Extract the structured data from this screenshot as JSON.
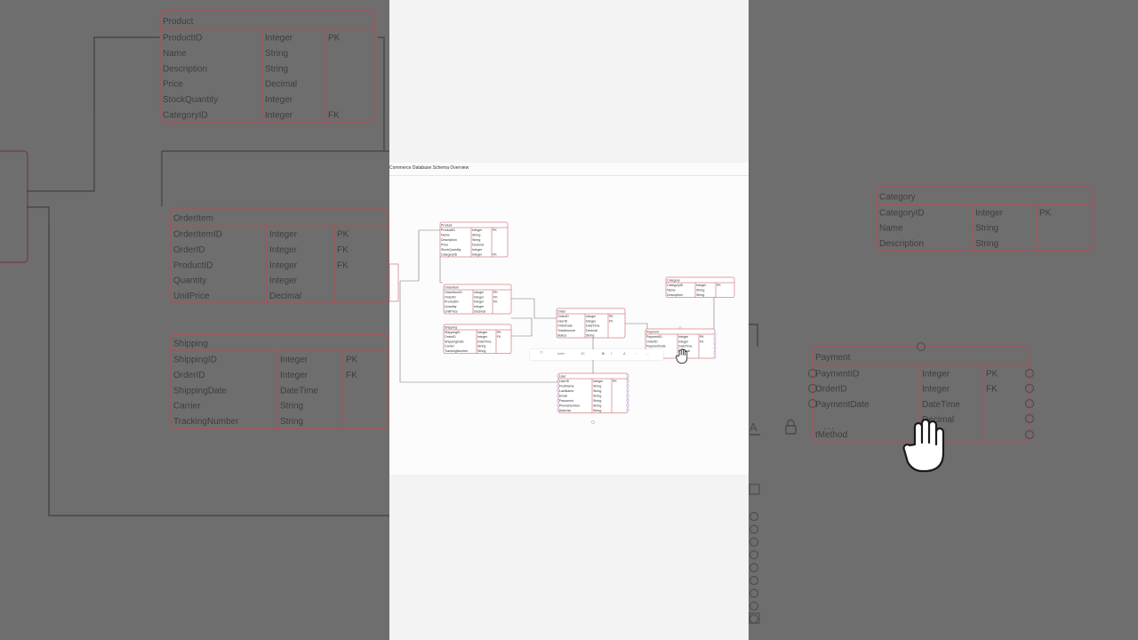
{
  "app": {
    "canvas_title": "Commerce Database Schema Overview"
  },
  "tables": {
    "product": {
      "name": "Product",
      "rows": [
        [
          "ProductID",
          "Integer",
          "PK"
        ],
        [
          "Name",
          "String",
          ""
        ],
        [
          "Description",
          "String",
          ""
        ],
        [
          "Price",
          "Decimal",
          ""
        ],
        [
          "StockQuantity",
          "Integer",
          ""
        ],
        [
          "CategoryID",
          "Integer",
          "FK"
        ]
      ]
    },
    "orderitem": {
      "name": "OrderItem",
      "rows": [
        [
          "OrderItemID",
          "Integer",
          "PK"
        ],
        [
          "OrderID",
          "Integer",
          "FK"
        ],
        [
          "ProductID",
          "Integer",
          "FK"
        ],
        [
          "Quantity",
          "Integer",
          ""
        ],
        [
          "UnitPrice",
          "Decimal",
          ""
        ]
      ]
    },
    "shipping": {
      "name": "Shipping",
      "rows": [
        [
          "ShippingID",
          "Integer",
          "PK"
        ],
        [
          "OrderID",
          "Integer",
          "FK"
        ],
        [
          "ShippingDate",
          "DateTime",
          ""
        ],
        [
          "Carrier",
          "String",
          ""
        ],
        [
          "TrackingNumber",
          "String",
          ""
        ]
      ]
    },
    "category": {
      "name": "Category",
      "rows": [
        [
          "CategoryID",
          "Integer",
          "PK"
        ],
        [
          "Name",
          "String",
          ""
        ],
        [
          "Description",
          "String",
          ""
        ]
      ]
    },
    "order": {
      "name": "Order",
      "rows": [
        [
          "OrderID",
          "Integer",
          "PK"
        ],
        [
          "UserID",
          "Integer",
          "FK"
        ],
        [
          "OrderDate",
          "DateTime",
          ""
        ],
        [
          "TotalAmount",
          "Decimal",
          ""
        ],
        [
          "Status",
          "String",
          ""
        ]
      ]
    },
    "payment": {
      "name": "Payment",
      "rows": [
        [
          "PaymentID",
          "Integer",
          "PK"
        ],
        [
          "OrderID",
          "Integer",
          "FK"
        ],
        [
          "PaymentDate",
          "DateTime",
          ""
        ],
        [
          "",
          "Decimal",
          ""
        ],
        [
          "tMethod",
          "",
          ""
        ]
      ]
    },
    "user": {
      "name": "User",
      "rows": [
        [
          "UserID",
          "Integer",
          "PK"
        ],
        [
          "FirstName",
          "String",
          ""
        ],
        [
          "LastName",
          "String",
          ""
        ],
        [
          "Email",
          "String",
          ""
        ],
        [
          "Password",
          "String",
          ""
        ],
        [
          "PhoneNumber",
          "String",
          ""
        ],
        [
          "Address",
          "String",
          ""
        ]
      ]
    }
  },
  "toolbar": {
    "font": "Inter",
    "size": "10",
    "bold": "B",
    "italic": "I",
    "text_color": "A",
    "more": "..."
  },
  "colors": {
    "table_border": "#c6474f",
    "link_line": "#555555",
    "handle": "#7a6fd6"
  },
  "icons": [
    "lock-icon",
    "hand-cursor-icon",
    "more-icon",
    "text-color-icon"
  ]
}
